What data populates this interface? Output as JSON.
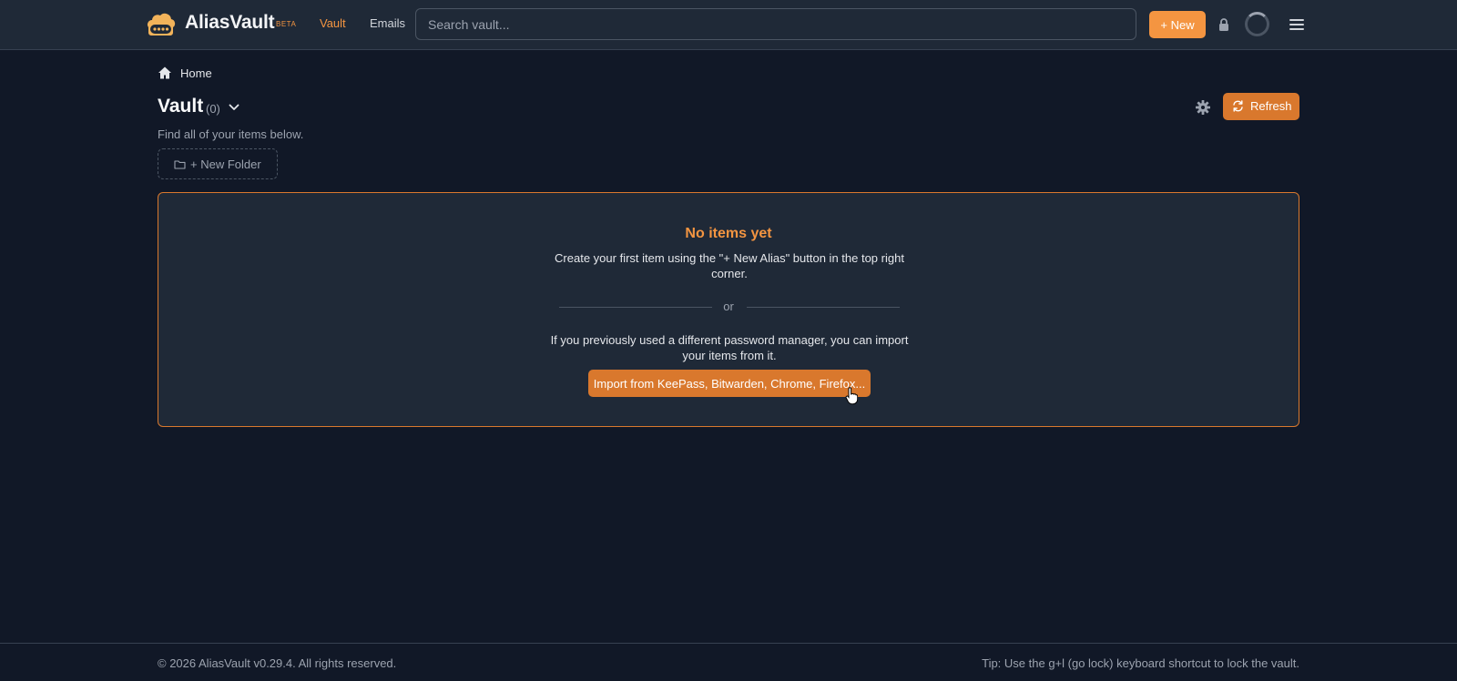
{
  "app": {
    "brand": "AliasVault",
    "badge": "BETA"
  },
  "header": {
    "nav": [
      {
        "label": "Vault",
        "active": true
      },
      {
        "label": "Emails",
        "active": false
      }
    ],
    "search_placeholder": "Search vault...",
    "new_button": "+ New",
    "icons": [
      "lock-icon",
      "loading-spinner",
      "menu-icon"
    ]
  },
  "breadcrumb": {
    "home": "Home"
  },
  "vault": {
    "title": "Vault",
    "count": "(0)",
    "subtitle": "Find all of your items below.",
    "refresh_label": "Refresh",
    "new_folder_label": "+ New Folder"
  },
  "empty_state": {
    "title": "No items yet",
    "description": "Create your first item using the \"+ New Alias\" button in the top right corner.",
    "divider": "or",
    "import_description": "If you previously used a different password manager, you can import your items from it.",
    "import_button": "Import from KeePass, Bitwarden, Chrome, Firefox..."
  },
  "footer": {
    "copyright": "© 2026 AliasVault v0.29.4. All rights reserved.",
    "tip": "Tip: Use the g+l (go lock) keyboard shortcut to lock the vault."
  },
  "colors": {
    "accent": "#f49541",
    "accent_dark": "#d9782d",
    "background": "#111827",
    "surface": "#1f2937"
  }
}
